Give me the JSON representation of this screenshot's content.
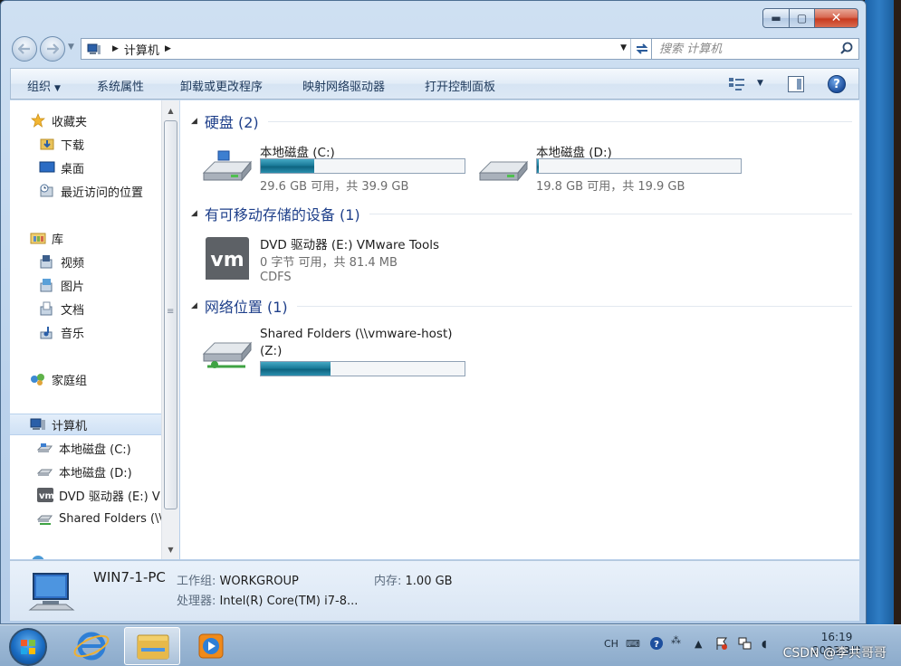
{
  "window": {
    "minimize_glyph": "▬",
    "maximize_glyph": "▢",
    "close_glyph": "✕"
  },
  "address": {
    "crumbs": [
      "计算机"
    ],
    "search_placeholder": "搜索 计算机"
  },
  "toolbar": {
    "organize": "组织",
    "system_properties": "系统属性",
    "uninstall": "卸载或更改程序",
    "map_drive": "映射网络驱动器",
    "control_panel": "打开控制面板"
  },
  "sidebar": {
    "favorites": "收藏夹",
    "downloads": "下载",
    "desktop": "桌面",
    "recent": "最近访问的位置",
    "libraries": "库",
    "videos": "视频",
    "pictures": "图片",
    "documents": "文档",
    "music": "音乐",
    "homegroup": "家庭组",
    "computer": "计算机",
    "drive_c": "本地磁盘 (C:)",
    "drive_d": "本地磁盘 (D:)",
    "drive_e": "DVD 驱动器 (E:) VMware Tools",
    "shared": "Shared Folders (\\\\vmware-host) (Z:)"
  },
  "groups": {
    "hard_disks": "硬盘 (2)",
    "removable": "有可移动存储的设备 (1)",
    "network": "网络位置 (1)"
  },
  "drives": {
    "c": {
      "name": "本地磁盘 (C:)",
      "info": "29.6 GB 可用，共 39.9 GB",
      "used_fraction": 0.26
    },
    "d": {
      "name": "本地磁盘 (D:)",
      "info": "19.8 GB 可用，共 19.9 GB",
      "used_fraction": 0.01
    },
    "e": {
      "name": "DVD 驱动器 (E:) VMware Tools",
      "info": "0 字节 可用，共 81.4 MB",
      "fs": "CDFS",
      "logo": "vm"
    },
    "z": {
      "name_line1": "Shared Folders (\\\\vmware-host)",
      "name_line2": "(Z:)",
      "used_fraction": 0.34
    }
  },
  "details": {
    "pc_name": "WIN7-1-PC",
    "workgroup_label": "工作组:",
    "workgroup": "WORKGROUP",
    "memory_label": "内存:",
    "memory": "1.00 GB",
    "cpu_label": "处理器:",
    "cpu": "Intel(R) Core(TM) i7-8..."
  },
  "taskbar": {
    "lang": "CH",
    "time": "16:19",
    "date": "2023/3/2",
    "watermark": "CSDN @李共哥哥"
  },
  "colors": {
    "accent": "#1e3f8a",
    "bar_fill": "#1b7b99",
    "taskbar": "#9bb7d4"
  }
}
